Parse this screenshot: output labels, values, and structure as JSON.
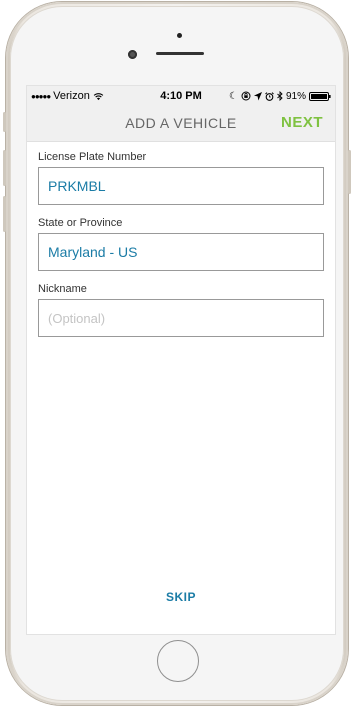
{
  "status_bar": {
    "carrier": "Verizon",
    "time": "4:10 PM",
    "battery": "91%",
    "icons": [
      "signal-dots-icon",
      "wifi-icon",
      "moon-icon",
      "lock-rotation-icon",
      "location-icon",
      "alarm-icon",
      "bluetooth-icon",
      "battery-icon"
    ]
  },
  "nav": {
    "title": "ADD A VEHICLE",
    "next_label": "NEXT"
  },
  "form": {
    "plate": {
      "label": "License Plate Number",
      "value": "PRKMBL"
    },
    "state": {
      "label": "State or Province",
      "value": "Maryland - US"
    },
    "nickname": {
      "label": "Nickname",
      "placeholder": "(Optional)"
    }
  },
  "skip_label": "SKIP",
  "colors": {
    "accent_green": "#7fc241",
    "accent_blue": "#1b7ca6"
  }
}
